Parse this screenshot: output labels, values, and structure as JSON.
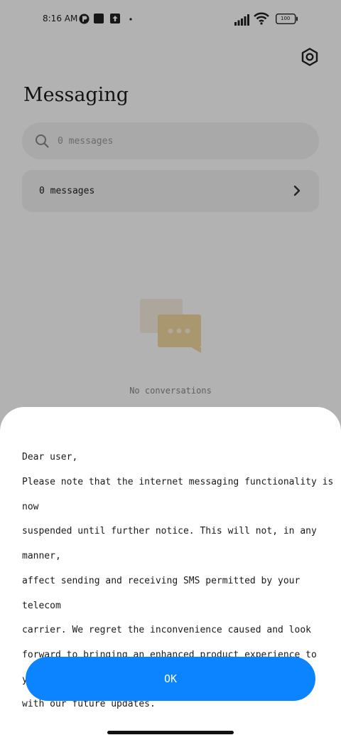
{
  "status_bar": {
    "time": "8:16 AM",
    "battery": "100",
    "icons_left": [
      "app-notification-icon",
      "square-notification-icon",
      "upload-notification-icon",
      "dot-icon"
    ],
    "icons_right": [
      "signal-icon",
      "wifi-icon",
      "battery-icon"
    ]
  },
  "header": {
    "title": "Messaging",
    "settings_icon": "gear-icon"
  },
  "search": {
    "placeholder": "0 messages"
  },
  "messages_row": {
    "label": "0 messages"
  },
  "empty_state": {
    "text": "No conversations"
  },
  "dialog": {
    "greeting": "Dear user,",
    "body": "Please note that the internet messaging functionality is now\nsuspended until further notice. This will not, in any manner,\naffect sending and receiving SMS permitted by your telecom\ncarrier. We regret the inconvenience caused and look\nforward to bringing an enhanced product experience to you\nwith our future updates.",
    "ok_label": "OK"
  },
  "colors": {
    "accent": "#0d84ff",
    "illustration": "#f0d9a0"
  }
}
